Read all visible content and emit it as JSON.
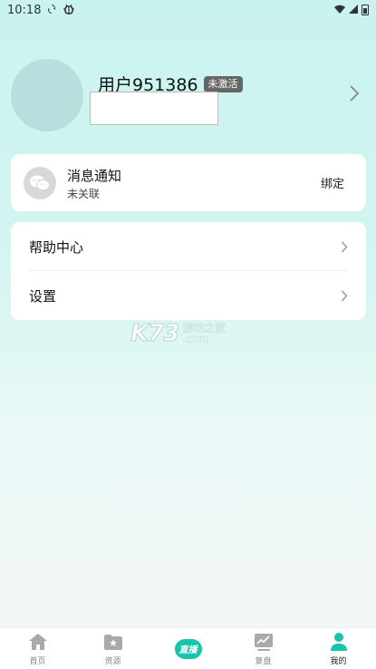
{
  "status_bar": {
    "time": "10:18",
    "icons": [
      "sync-icon",
      "bug-icon",
      "wifi-icon",
      "signal-icon",
      "battery-icon"
    ]
  },
  "profile": {
    "username": "用户951386",
    "badge": "未激活",
    "name_input_value": ""
  },
  "notify_card": {
    "title": "消息通知",
    "subtitle": "未关联",
    "action": "绑定",
    "icon": "wechat-icon"
  },
  "menu": {
    "items": [
      {
        "label": "帮助中心",
        "icon": "chevron-right-icon"
      },
      {
        "label": "设置",
        "icon": "chevron-right-icon"
      }
    ]
  },
  "watermark": {
    "logo": "K73",
    "text": "游戏之家",
    "domain": ".com"
  },
  "tab_bar": {
    "tabs": [
      {
        "label": "首页",
        "icon": "home-icon",
        "active": false
      },
      {
        "label": "资源",
        "icon": "folder-star-icon",
        "active": false
      },
      {
        "label": "直播",
        "icon": "live-icon",
        "active": false
      },
      {
        "label": "复盘",
        "icon": "chart-icon",
        "active": false
      },
      {
        "label": "我的",
        "icon": "user-icon",
        "active": true
      }
    ]
  },
  "colors": {
    "accent": "#19c4ad",
    "background_top": "#c9f3ef",
    "badge": "#666666"
  }
}
